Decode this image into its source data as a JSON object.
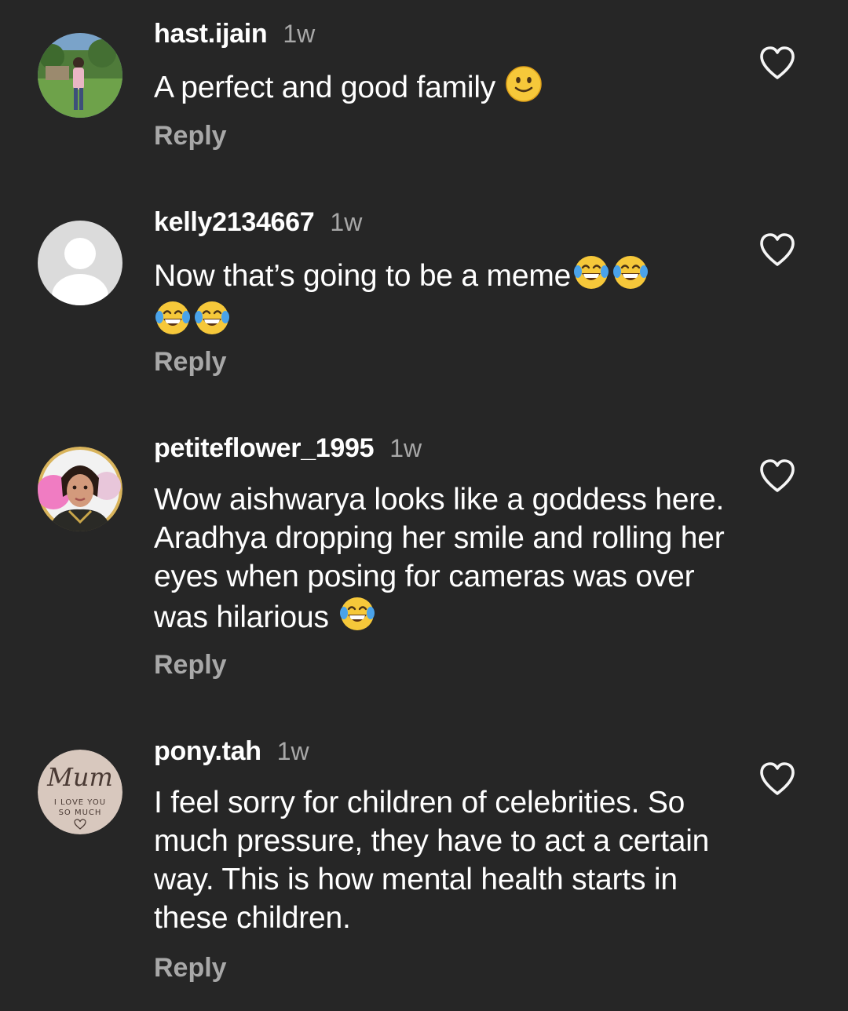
{
  "comments": [
    {
      "username": "hast.ijain",
      "time": "1w",
      "text": "A perfect and good family",
      "emoji": [
        "slightly-smiling-face"
      ],
      "reply": "Reply",
      "avatar": "photo-person-in-garden"
    },
    {
      "username": "kelly2134667",
      "time": "1w",
      "text": "Now that’s going to be a meme",
      "emoji": [
        "face-with-tears-of-joy",
        "face-with-tears-of-joy",
        "face-with-tears-of-joy",
        "face-with-tears-of-joy"
      ],
      "reply": "Reply",
      "avatar": "default-profile-silhouette"
    },
    {
      "username": "petiteflower_1995",
      "time": "1w",
      "text": "Wow aishwarya looks like a goddess here. Aradhya dropping her smile and rolling her eyes when posing for cameras was over was hilarious",
      "emoji": [
        "face-with-tears-of-joy"
      ],
      "reply": "Reply",
      "avatar": "photo-selfie-portrait"
    },
    {
      "username": "pony.tah",
      "time": "1w",
      "text": "I feel sorry for children of celebrities. So much pressure, they have to act a certain way. This is how mental health starts in these children.",
      "emoji": [],
      "reply": "Reply",
      "avatar": "mum-i-love-you-badge",
      "avatar_text": {
        "title": "Mum",
        "line1": "I LOVE YOU",
        "line2": "SO MUCH"
      }
    }
  ],
  "colors": {
    "background": "#262626",
    "primary_text": "#ffffff",
    "secondary_text": "#a8a8a8",
    "heart_outline": "#f5f5f5"
  }
}
